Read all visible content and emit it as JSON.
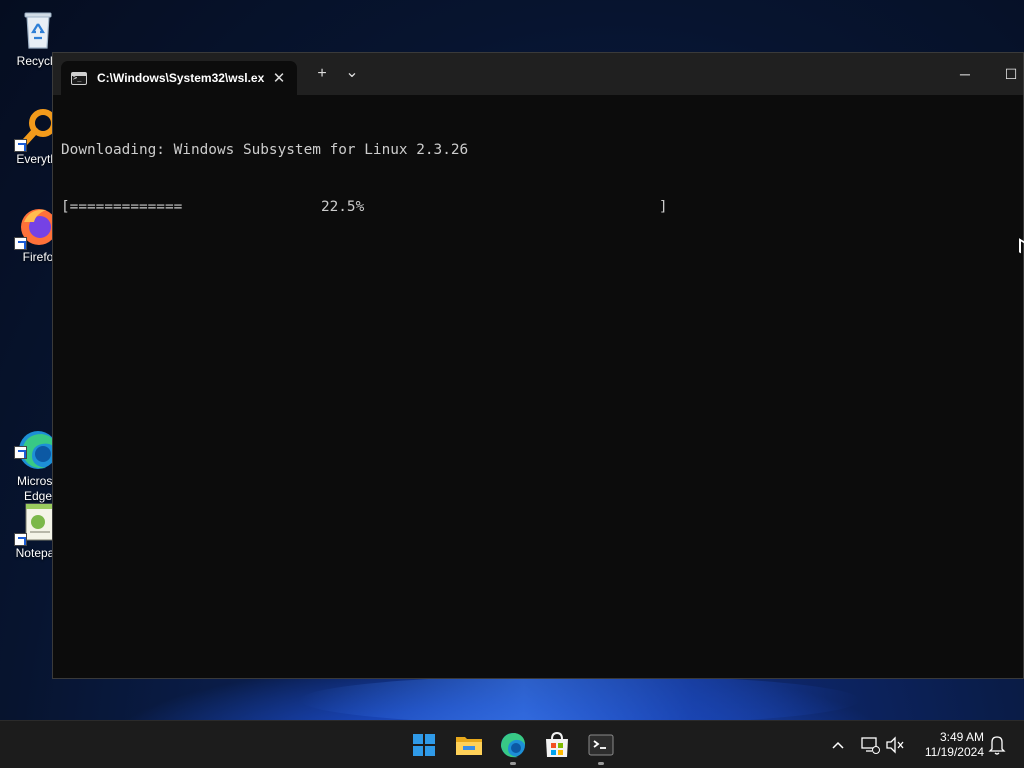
{
  "desktop": {
    "icons": [
      {
        "label": "Recycle",
        "icon": "recycle-bin-icon"
      },
      {
        "label": "Everythi",
        "icon": "everything-search-icon"
      },
      {
        "label": "Firefo",
        "icon": "firefox-icon"
      },
      {
        "label": "Microso\nEdge",
        "icon": "edge-icon"
      },
      {
        "label": "Notepac",
        "icon": "notepad-icon"
      }
    ]
  },
  "terminal": {
    "tab_title": "C:\\Windows\\System32\\wsl.ex",
    "close_glyph": "✕",
    "new_tab_glyph": "+",
    "dropdown_glyph": "⌄",
    "minimize_glyph": "─",
    "maximize_glyph": "☐",
    "line1": "Downloading: Windows Subsystem for Linux 2.3.26",
    "progress_open": "[",
    "progress_fill": "=============",
    "progress_percent": "22.5%",
    "progress_close": "]",
    "progress_value": 22.5
  },
  "taskbar": {
    "apps": [
      "start-icon",
      "file-explorer-icon",
      "edge-icon",
      "store-icon",
      "terminal-icon"
    ],
    "time": "3:49 AM",
    "date": "11/19/2024"
  },
  "colors": {
    "terminal_bg": "#0c0c0c",
    "titlebar_bg": "#202020",
    "text": "#cccccc",
    "taskbar_bg": "#1c1c1c"
  }
}
